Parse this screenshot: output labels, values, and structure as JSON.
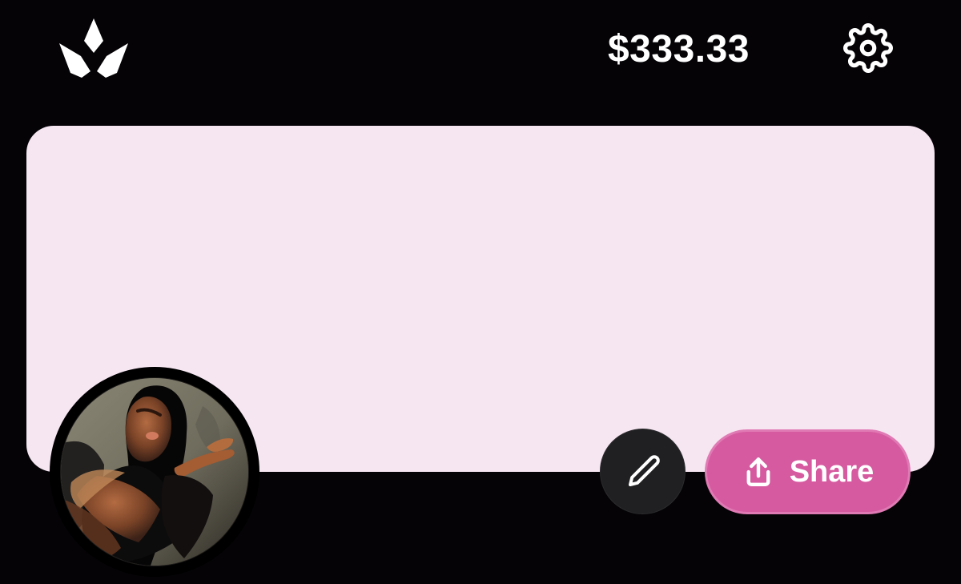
{
  "header": {
    "logo_icon": "crown-icon",
    "balance": "$333.33",
    "settings_icon": "gear-icon"
  },
  "profile": {
    "banner_color": "#f6e6f2",
    "avatar_type": "profile-photo"
  },
  "actions": {
    "edit_icon": "pencil-icon",
    "share_icon": "share-upload-icon",
    "share_label": "Share",
    "share_color": "#d65aa0",
    "edit_color": "#202022"
  },
  "theme": {
    "background": "#050306",
    "text": "#ffffff"
  }
}
